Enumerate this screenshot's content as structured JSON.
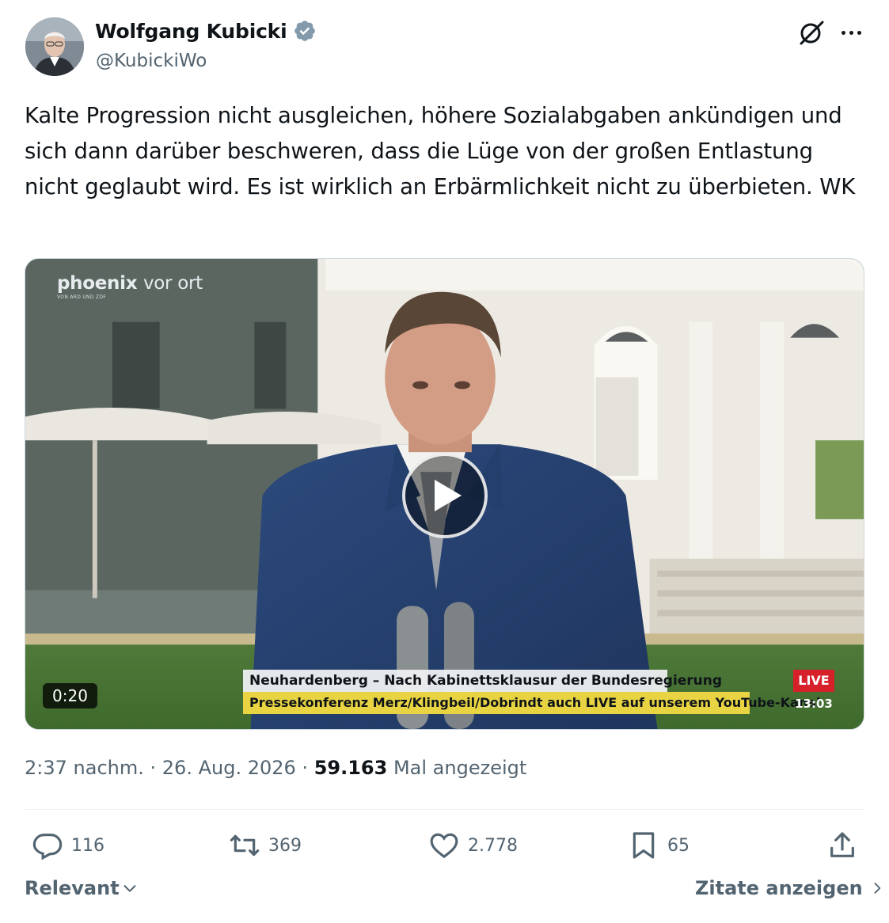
{
  "author": {
    "name": "Wolfgang Kubicki",
    "handle": "@KubickiWo",
    "verified": true
  },
  "tweet": {
    "text": "Kalte Progression nicht ausgleichen, höhere Sozialabgaben ankündigen und sich dann darüber beschweren, dass die Lüge von der großen Entlastung nicht geglaubt wird. Es ist wirklich an Erbärmlichkeit nicht zu überbieten. WK"
  },
  "media": {
    "channel_logo": "phoenix",
    "channel_logo_suffix": "vor ort",
    "channel_subline": "VON ARD UND ZDF",
    "duration": "0:20",
    "lower_third_title": "Neuhardenberg – Nach Kabinettsklausur der Bundesregierung",
    "lower_third_ticker": "Pressekonferenz Merz/Klingbeil/Dobrindt auch LIVE auf unserem YouTube-Kanal",
    "live_badge": "LIVE",
    "clock": "13:03"
  },
  "meta": {
    "time": "2:37 nachm.",
    "separator": "·",
    "date": "26. Aug. 2026",
    "views": "59.163",
    "views_label": "Mal angezeigt"
  },
  "actions": {
    "replies": "116",
    "reposts": "369",
    "likes": "2.778",
    "bookmarks": "65"
  },
  "footer": {
    "sort_label": "Relevant",
    "quotes_label": "Zitate anzeigen"
  },
  "colors": {
    "text": "#0f1419",
    "secondary": "#536471",
    "verified_badge": "#829aab",
    "live_red": "#d6212a",
    "ticker_yellow": "#e8d443"
  }
}
